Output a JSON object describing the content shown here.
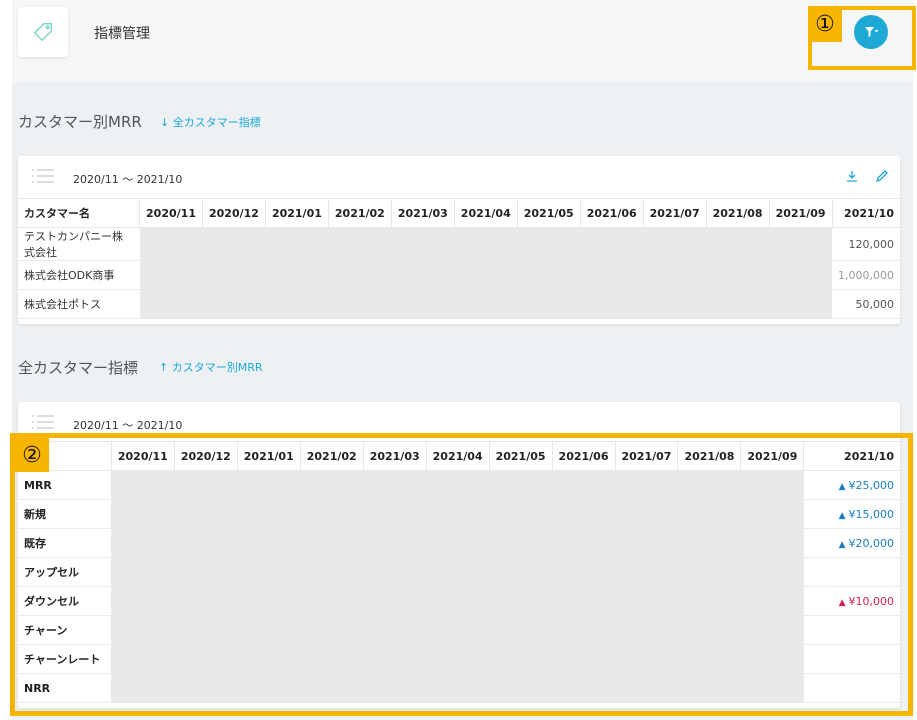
{
  "header": {
    "title": "指標管理"
  },
  "callouts": {
    "one": "①",
    "two": "②"
  },
  "section1": {
    "title": "カスタマー別MRR",
    "link": "↓ 全カスタマー指標",
    "range": "2020/11 ～ 2021/10",
    "name_header": "カスタマー名",
    "columns": [
      "2020/11",
      "2020/12",
      "2021/01",
      "2021/02",
      "2021/03",
      "2021/04",
      "2021/05",
      "2021/06",
      "2021/07",
      "2021/08",
      "2021/09",
      "2021/10"
    ],
    "rows": [
      {
        "name": "テストカンパニー株式会社",
        "value": "120,000"
      },
      {
        "name": "株式会社ODK商事",
        "value": "1,000,000"
      },
      {
        "name": "株式会社ポトス",
        "value": "50,000"
      }
    ]
  },
  "section2": {
    "title": "全カスタマー指標",
    "link": "↑ カスタマー別MRR",
    "range": "2020/11 ～ 2021/10",
    "columns": [
      "2020/11",
      "2020/12",
      "2021/01",
      "2021/02",
      "2021/03",
      "2021/04",
      "2021/05",
      "2021/06",
      "2021/07",
      "2021/08",
      "2021/09",
      "2021/10"
    ],
    "rows": [
      {
        "name": "MRR",
        "value": "¥25,000",
        "trend": "up"
      },
      {
        "name": "新規",
        "value": "¥15,000",
        "trend": "up"
      },
      {
        "name": "既存",
        "value": "¥20,000",
        "trend": "up"
      },
      {
        "name": "アップセル",
        "value": "",
        "trend": ""
      },
      {
        "name": "ダウンセル",
        "value": "¥10,000",
        "trend": "down"
      },
      {
        "name": "チャーン",
        "value": "",
        "trend": ""
      },
      {
        "name": "チャーンレート",
        "value": "",
        "trend": ""
      },
      {
        "name": "NRR",
        "value": "",
        "trend": ""
      }
    ]
  },
  "colors": {
    "accent": "#1ea8d6",
    "callout": "#f7b500",
    "down": "#d0234f"
  },
  "icons": {
    "logo": "tag-icon",
    "filter": "filter-icon",
    "list": "list-icon",
    "download": "download-icon",
    "edit": "pencil-icon",
    "trend": "caret-up-icon"
  }
}
